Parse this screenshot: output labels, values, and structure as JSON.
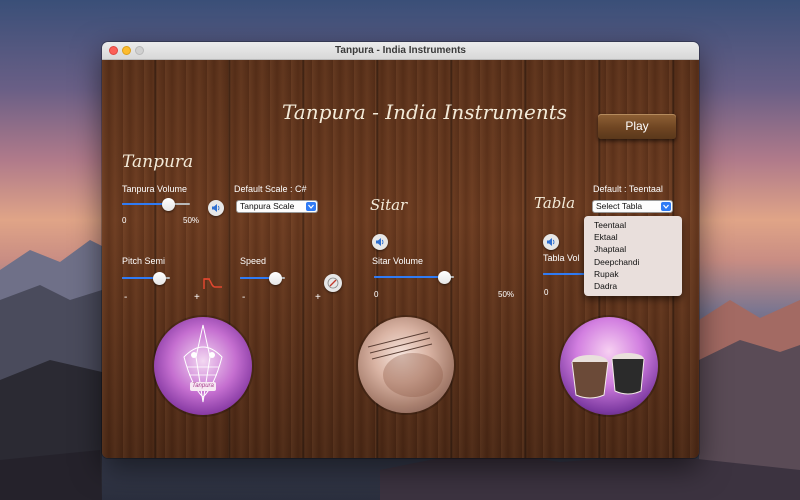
{
  "window": {
    "title": "Tanpura - India Instruments"
  },
  "app": {
    "heading": "Tanpura - India Instruments",
    "play_label": "Play",
    "tanpura": {
      "title": "Tanpura",
      "volume_label": "Tanpura Volume",
      "volume_min": "0",
      "volume_max": "50%",
      "volume_level": 0.68,
      "default_scale_label": "Default Scale  :  C#",
      "scale_select_value": "Tanpura Scale",
      "pitch_label": "Pitch Semi",
      "pitch_minus": "-",
      "pitch_plus": "+",
      "pitch_level": 0.78,
      "speed_label": "Speed",
      "speed_minus": "-",
      "speed_plus": "+",
      "speed_level": 0.78
    },
    "sitar": {
      "title": "Sitar",
      "volume_label": "Sitar  Volume",
      "volume_min": "0",
      "volume_max": "50%",
      "volume_level": 0.87
    },
    "tabla": {
      "title": "Tabla",
      "default_label": "Default : Teentaal",
      "select_value": "Select Tabla",
      "volume_label": "Tabla Vol",
      "volume_min": "0",
      "options": [
        "Teentaal",
        "Ektaal",
        "Jhaptaal",
        "Deepchandi",
        "Rupak",
        "Dadra"
      ]
    },
    "tanpura_image_label": "Tanpura"
  },
  "colors": {
    "accent": "#2f7bf5",
    "wood": "#6b3a1f",
    "script_text": "#f3ead8"
  }
}
